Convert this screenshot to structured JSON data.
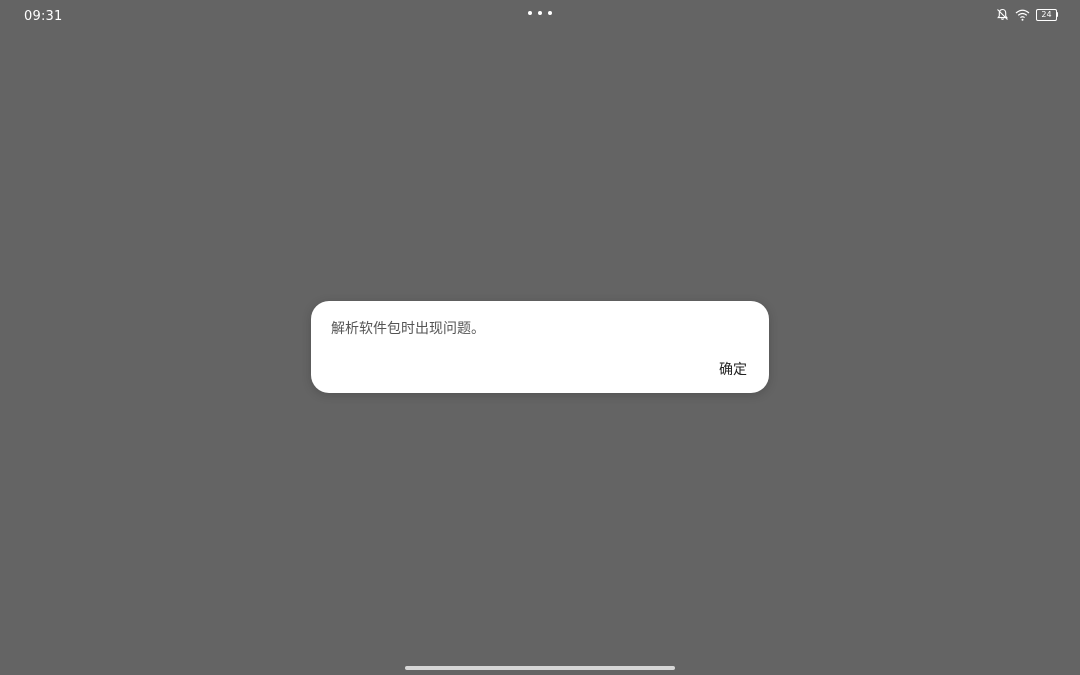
{
  "status_bar": {
    "time": "09:31",
    "battery_level": "24",
    "icons": [
      "notifications-muted-icon",
      "wifi-icon",
      "battery-icon"
    ]
  },
  "dialog": {
    "message": "解析软件包时出现问题。",
    "ok_label": "确定"
  },
  "colors": {
    "scrim": "#646464",
    "dialog_bg": "#ffffff",
    "message_text": "#555555",
    "button_text": "#222222"
  }
}
